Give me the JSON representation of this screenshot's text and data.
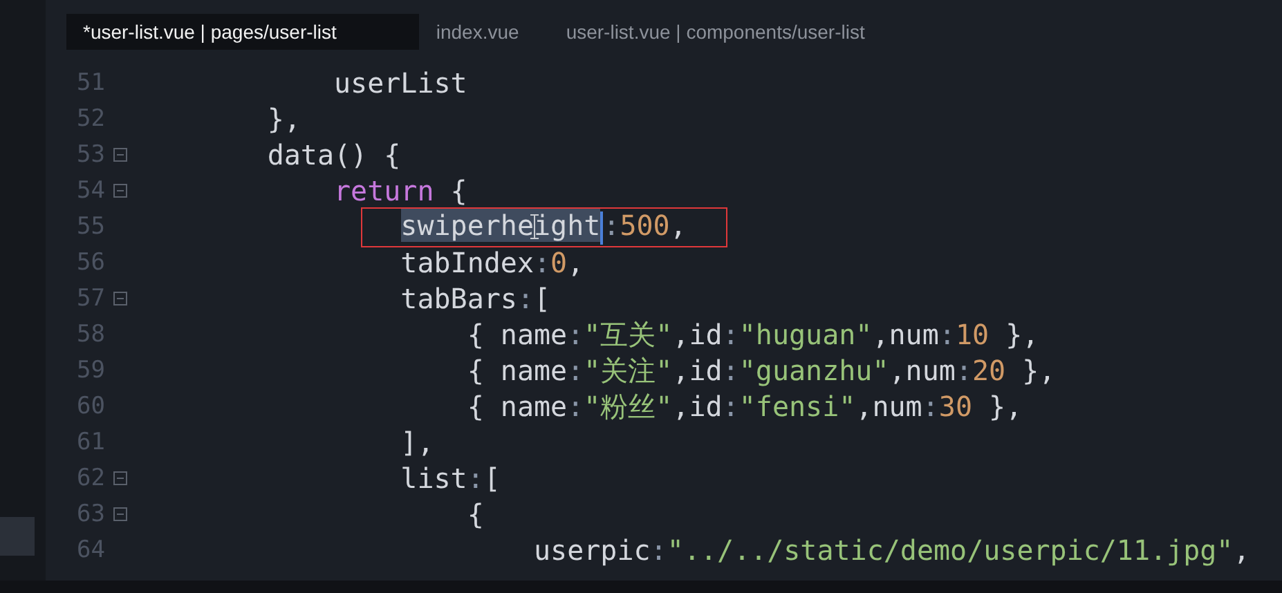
{
  "tabs": [
    {
      "label": "*user-list.vue | pages/user-list",
      "selected": true
    },
    {
      "label": "index.vue",
      "selected": false
    },
    {
      "label": "user-list.vue | components/user-list",
      "selected": false
    }
  ],
  "lines": [
    {
      "number": "51",
      "fold": false,
      "boxed": false,
      "tokens": [
        {
          "text": "            userList",
          "kind": "plain"
        }
      ]
    },
    {
      "number": "52",
      "fold": false,
      "boxed": false,
      "tokens": [
        {
          "text": "        },",
          "kind": "plain"
        }
      ]
    },
    {
      "number": "53",
      "fold": true,
      "boxed": false,
      "tokens": [
        {
          "text": "        data() {",
          "kind": "plain"
        }
      ]
    },
    {
      "number": "54",
      "fold": true,
      "boxed": false,
      "tokens": [
        {
          "text": "            return",
          "kind": "keyword"
        },
        {
          "text": " {",
          "kind": "plain"
        }
      ]
    },
    {
      "number": "55",
      "fold": false,
      "boxed": true,
      "tokens": [
        {
          "text": "                swiperheight",
          "kind": "selection"
        },
        {
          "text": ":",
          "kind": "punct"
        },
        {
          "text": "500",
          "kind": "number"
        },
        {
          "text": ",",
          "kind": "plain"
        }
      ]
    },
    {
      "number": "56",
      "fold": false,
      "boxed": false,
      "tokens": [
        {
          "text": "                tabIndex",
          "kind": "plain"
        },
        {
          "text": ":",
          "kind": "punct"
        },
        {
          "text": "0",
          "kind": "number"
        },
        {
          "text": ",",
          "kind": "plain"
        }
      ]
    },
    {
      "number": "57",
      "fold": true,
      "boxed": false,
      "tokens": [
        {
          "text": "                tabBars",
          "kind": "plain"
        },
        {
          "text": ":",
          "kind": "punct"
        },
        {
          "text": "[",
          "kind": "plain"
        }
      ]
    },
    {
      "number": "58",
      "fold": false,
      "boxed": false,
      "tokens": [
        {
          "text": "                    { name",
          "kind": "plain"
        },
        {
          "text": ":",
          "kind": "punct"
        },
        {
          "text": "\"互关\"",
          "kind": "string"
        },
        {
          "text": ",id",
          "kind": "plain"
        },
        {
          "text": ":",
          "kind": "punct"
        },
        {
          "text": "\"huguan\"",
          "kind": "string"
        },
        {
          "text": ",num",
          "kind": "plain"
        },
        {
          "text": ":",
          "kind": "punct"
        },
        {
          "text": "10",
          "kind": "number"
        },
        {
          "text": " },",
          "kind": "plain"
        }
      ]
    },
    {
      "number": "59",
      "fold": false,
      "boxed": false,
      "tokens": [
        {
          "text": "                    { name",
          "kind": "plain"
        },
        {
          "text": ":",
          "kind": "punct"
        },
        {
          "text": "\"关注\"",
          "kind": "string"
        },
        {
          "text": ",id",
          "kind": "plain"
        },
        {
          "text": ":",
          "kind": "punct"
        },
        {
          "text": "\"guanzhu\"",
          "kind": "string"
        },
        {
          "text": ",num",
          "kind": "plain"
        },
        {
          "text": ":",
          "kind": "punct"
        },
        {
          "text": "20",
          "kind": "number"
        },
        {
          "text": " },",
          "kind": "plain"
        }
      ]
    },
    {
      "number": "60",
      "fold": false,
      "boxed": false,
      "tokens": [
        {
          "text": "                    { name",
          "kind": "plain"
        },
        {
          "text": ":",
          "kind": "punct"
        },
        {
          "text": "\"粉丝\"",
          "kind": "string"
        },
        {
          "text": ",id",
          "kind": "plain"
        },
        {
          "text": ":",
          "kind": "punct"
        },
        {
          "text": "\"fensi\"",
          "kind": "string"
        },
        {
          "text": ",num",
          "kind": "plain"
        },
        {
          "text": ":",
          "kind": "punct"
        },
        {
          "text": "30",
          "kind": "number"
        },
        {
          "text": " },",
          "kind": "plain"
        }
      ]
    },
    {
      "number": "61",
      "fold": false,
      "boxed": false,
      "tokens": [
        {
          "text": "                ],",
          "kind": "plain"
        }
      ]
    },
    {
      "number": "62",
      "fold": true,
      "boxed": false,
      "tokens": [
        {
          "text": "                list",
          "kind": "plain"
        },
        {
          "text": ":",
          "kind": "punct"
        },
        {
          "text": "[",
          "kind": "plain"
        }
      ]
    },
    {
      "number": "63",
      "fold": true,
      "boxed": false,
      "tokens": [
        {
          "text": "                    {",
          "kind": "plain"
        }
      ]
    },
    {
      "number": "64",
      "fold": false,
      "boxed": false,
      "tokens": [
        {
          "text": "                        userpic",
          "kind": "plain"
        },
        {
          "text": ":",
          "kind": "punct"
        },
        {
          "text": "\"../../static/demo/userpic/11.jpg\"",
          "kind": "string"
        },
        {
          "text": ",",
          "kind": "plain"
        }
      ]
    }
  ]
}
